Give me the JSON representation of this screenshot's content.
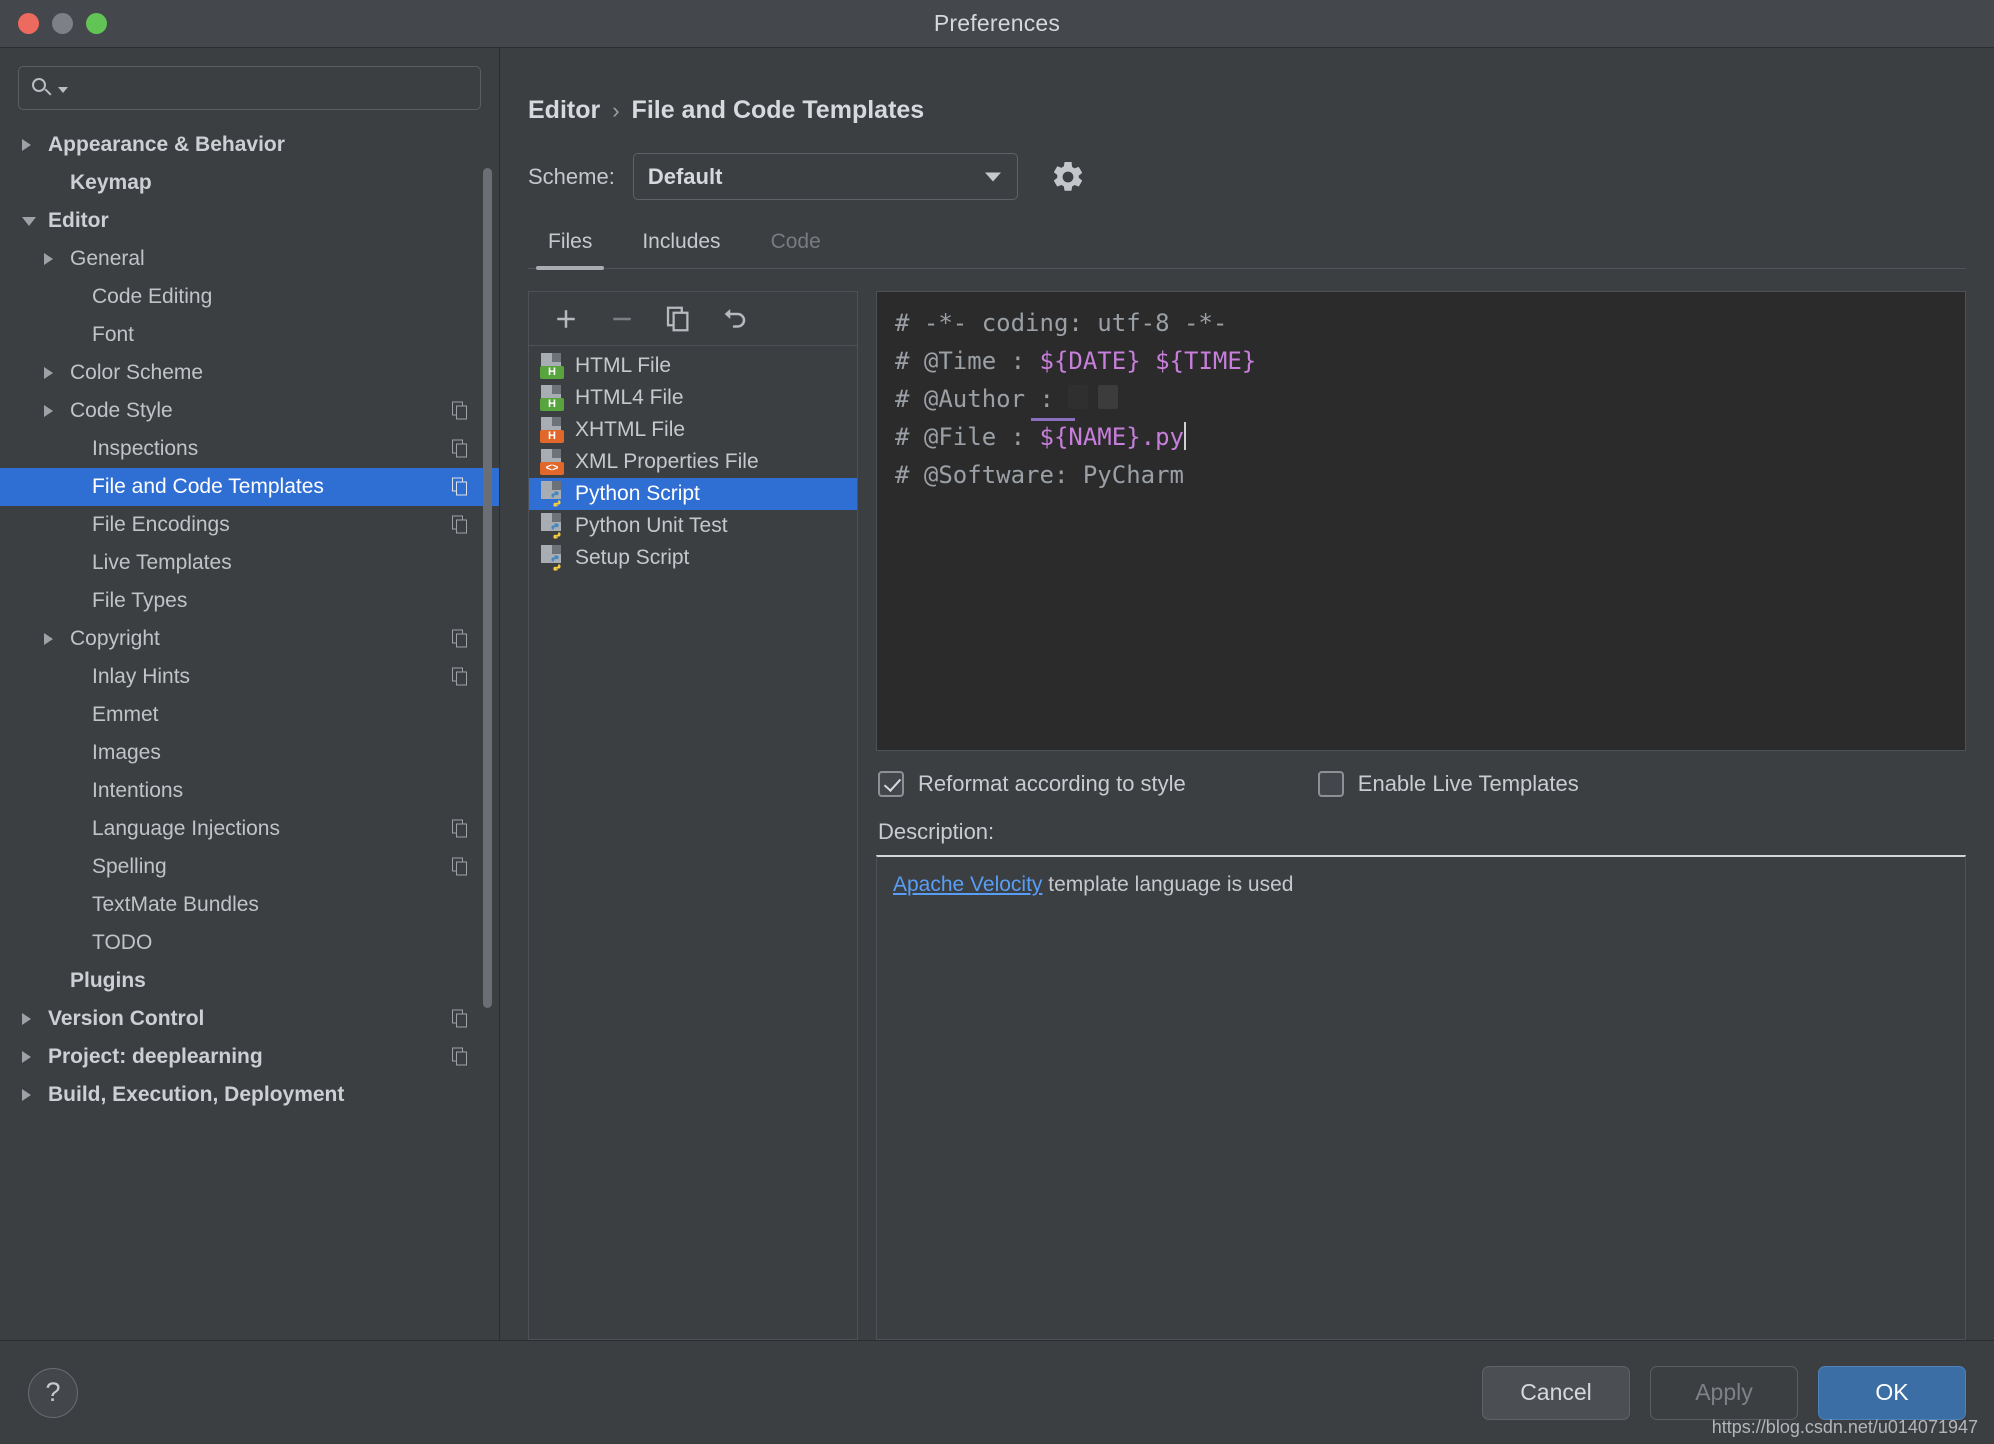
{
  "window": {
    "title": "Preferences",
    "traffic_lights": [
      "close-red",
      "minimize-gray",
      "zoom-green"
    ]
  },
  "sidebar": {
    "search": {
      "value": "",
      "placeholder": ""
    },
    "items": [
      {
        "label": "Appearance & Behavior",
        "indent": 0,
        "arrow": "right",
        "bold": true,
        "badge": false,
        "selected": false
      },
      {
        "label": "Keymap",
        "indent": 1,
        "arrow": "none",
        "bold": true,
        "badge": false,
        "selected": false
      },
      {
        "label": "Editor",
        "indent": 0,
        "arrow": "down",
        "bold": true,
        "badge": false,
        "selected": false
      },
      {
        "label": "General",
        "indent": 1,
        "arrow": "right",
        "bold": false,
        "badge": false,
        "selected": false
      },
      {
        "label": "Code Editing",
        "indent": 2,
        "arrow": "none",
        "bold": false,
        "badge": false,
        "selected": false
      },
      {
        "label": "Font",
        "indent": 2,
        "arrow": "none",
        "bold": false,
        "badge": false,
        "selected": false
      },
      {
        "label": "Color Scheme",
        "indent": 1,
        "arrow": "right",
        "bold": false,
        "badge": false,
        "selected": false
      },
      {
        "label": "Code Style",
        "indent": 1,
        "arrow": "right",
        "bold": false,
        "badge": true,
        "selected": false
      },
      {
        "label": "Inspections",
        "indent": 2,
        "arrow": "none",
        "bold": false,
        "badge": true,
        "selected": false
      },
      {
        "label": "File and Code Templates",
        "indent": 2,
        "arrow": "none",
        "bold": false,
        "badge": true,
        "selected": true
      },
      {
        "label": "File Encodings",
        "indent": 2,
        "arrow": "none",
        "bold": false,
        "badge": true,
        "selected": false
      },
      {
        "label": "Live Templates",
        "indent": 2,
        "arrow": "none",
        "bold": false,
        "badge": false,
        "selected": false
      },
      {
        "label": "File Types",
        "indent": 2,
        "arrow": "none",
        "bold": false,
        "badge": false,
        "selected": false
      },
      {
        "label": "Copyright",
        "indent": 1,
        "arrow": "right",
        "bold": false,
        "badge": true,
        "selected": false
      },
      {
        "label": "Inlay Hints",
        "indent": 2,
        "arrow": "none",
        "bold": false,
        "badge": true,
        "selected": false
      },
      {
        "label": "Emmet",
        "indent": 2,
        "arrow": "none",
        "bold": false,
        "badge": false,
        "selected": false
      },
      {
        "label": "Images",
        "indent": 2,
        "arrow": "none",
        "bold": false,
        "badge": false,
        "selected": false
      },
      {
        "label": "Intentions",
        "indent": 2,
        "arrow": "none",
        "bold": false,
        "badge": false,
        "selected": false
      },
      {
        "label": "Language Injections",
        "indent": 2,
        "arrow": "none",
        "bold": false,
        "badge": true,
        "selected": false
      },
      {
        "label": "Spelling",
        "indent": 2,
        "arrow": "none",
        "bold": false,
        "badge": true,
        "selected": false
      },
      {
        "label": "TextMate Bundles",
        "indent": 2,
        "arrow": "none",
        "bold": false,
        "badge": false,
        "selected": false
      },
      {
        "label": "TODO",
        "indent": 2,
        "arrow": "none",
        "bold": false,
        "badge": false,
        "selected": false
      },
      {
        "label": "Plugins",
        "indent": 1,
        "arrow": "none",
        "bold": true,
        "badge": false,
        "selected": false
      },
      {
        "label": "Version Control",
        "indent": 0,
        "arrow": "right",
        "bold": true,
        "badge": true,
        "selected": false
      },
      {
        "label": "Project: deeplearning",
        "indent": 0,
        "arrow": "right",
        "bold": true,
        "badge": true,
        "selected": false
      },
      {
        "label": "Build, Execution, Deployment",
        "indent": 0,
        "arrow": "right",
        "bold": true,
        "badge": false,
        "selected": false
      }
    ]
  },
  "breadcrumb": {
    "parent": "Editor",
    "separator": "›",
    "current": "File and Code Templates"
  },
  "scheme": {
    "label": "Scheme:",
    "value": "Default"
  },
  "tabs": [
    {
      "label": "Files",
      "active": true,
      "disabled": false
    },
    {
      "label": "Includes",
      "active": false,
      "disabled": false
    },
    {
      "label": "Code",
      "active": false,
      "disabled": true
    }
  ],
  "file_toolbar": [
    {
      "name": "add-template-button",
      "glyph": "+"
    },
    {
      "name": "remove-template-button",
      "glyph": "−"
    },
    {
      "name": "copy-template-button",
      "glyph": "copy"
    },
    {
      "name": "reset-template-button",
      "glyph": "undo"
    }
  ],
  "file_list": [
    {
      "label": "HTML File",
      "icon": "html-file-icon",
      "tag": "H",
      "tag_color": "green",
      "selected": false
    },
    {
      "label": "HTML4 File",
      "icon": "html4-file-icon",
      "tag": "H",
      "tag_color": "green",
      "selected": false
    },
    {
      "label": "XHTML File",
      "icon": "xhtml-file-icon",
      "tag": "H",
      "tag_color": "orange",
      "selected": false
    },
    {
      "label": "XML Properties File",
      "icon": "xml-properties-file-icon",
      "tag": "<>",
      "tag_color": "orange",
      "selected": false
    },
    {
      "label": "Python Script",
      "icon": "python-file-icon",
      "tag": "py",
      "tag_color": "python",
      "selected": true
    },
    {
      "label": "Python Unit Test",
      "icon": "python-file-icon",
      "tag": "py",
      "tag_color": "python",
      "selected": false
    },
    {
      "label": "Setup Script",
      "icon": "python-file-icon",
      "tag": "py",
      "tag_color": "python",
      "selected": false
    }
  ],
  "editor": {
    "line1_prefix": "# -*- coding: utf-8 -*-",
    "line2_prefix": "# @Time : ",
    "line2_date": "${DATE}",
    "line2_time": "${TIME}",
    "line3_prefix": "# @Author : ",
    "line4_prefix": "# @File : ",
    "line4_name": "${NAME}",
    "line4_suffix": ".py",
    "line5": "# @Software: PyCharm"
  },
  "options": {
    "reformat": {
      "label": "Reformat according to style",
      "checked": true
    },
    "live_templates": {
      "label": "Enable Live Templates",
      "checked": false
    }
  },
  "description": {
    "label": "Description:",
    "link_text": "Apache Velocity",
    "rest_text": " template language is used"
  },
  "footer": {
    "help": "?",
    "cancel": "Cancel",
    "apply": "Apply",
    "ok": "OK",
    "watermark": "https://blog.csdn.net/u014071947"
  },
  "colors": {
    "selection": "#2f6ed3",
    "primary_button": "#3a6ea5",
    "link": "#589df6",
    "template_var": "#c77fdb",
    "window_bg": "#3c3f41",
    "editor_bg": "#2b2b2b"
  }
}
